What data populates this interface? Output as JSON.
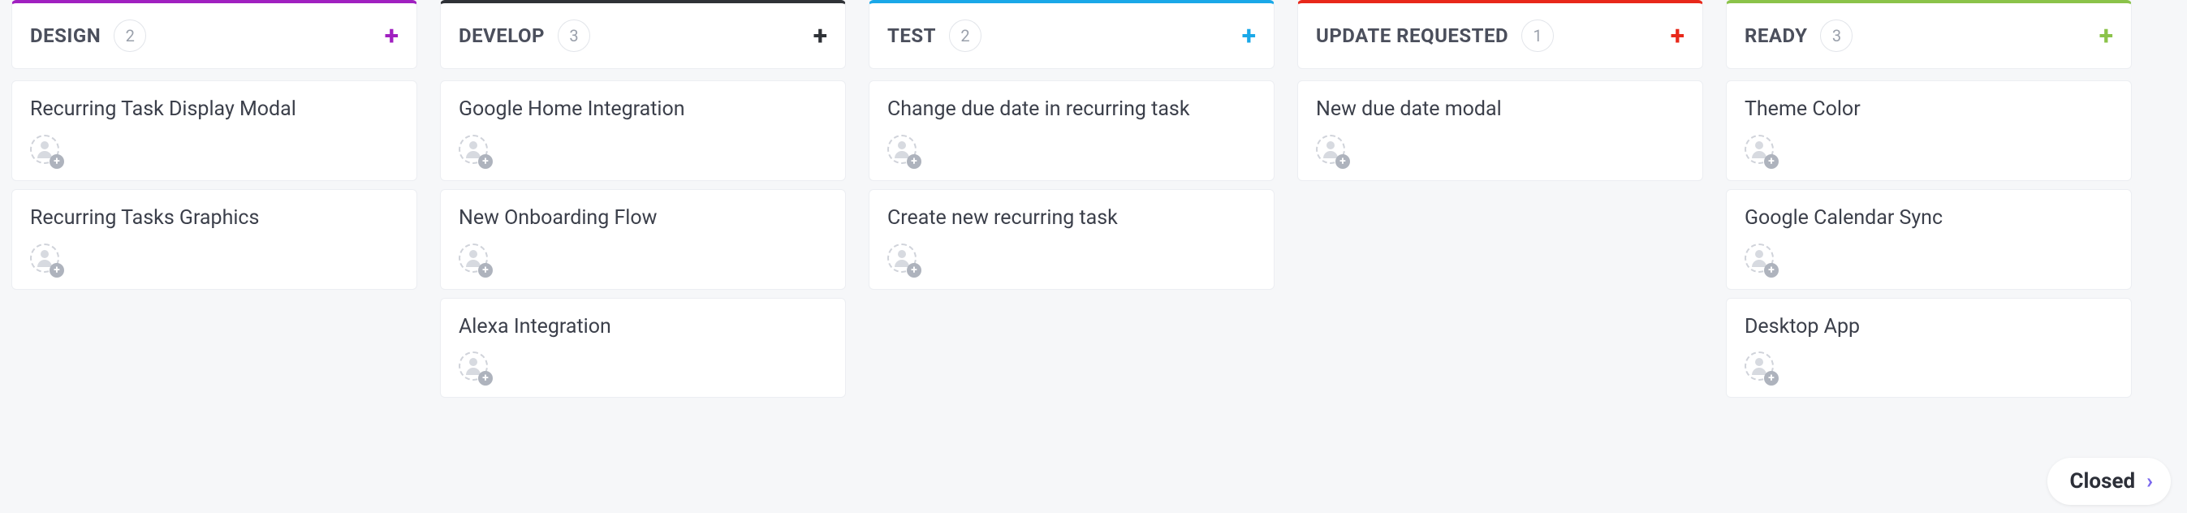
{
  "closed_label": "Closed",
  "columns": [
    {
      "id": "design",
      "title": "DESIGN",
      "count": 2,
      "accent": "#a020c0",
      "add_color": "#a020c0",
      "cards": [
        {
          "title": "Recurring Task Display Modal"
        },
        {
          "title": "Recurring Tasks Graphics"
        }
      ]
    },
    {
      "id": "develop",
      "title": "DEVELOP",
      "count": 3,
      "accent": "#2f3237",
      "add_color": "#2f3237",
      "cards": [
        {
          "title": "Google Home Integration"
        },
        {
          "title": "New Onboarding Flow"
        },
        {
          "title": "Alexa Integration"
        }
      ]
    },
    {
      "id": "test",
      "title": "TEST",
      "count": 2,
      "accent": "#1aa8e8",
      "add_color": "#1aa8e8",
      "cards": [
        {
          "title": "Change due date in recurring task"
        },
        {
          "title": "Create new recurring task"
        }
      ]
    },
    {
      "id": "update-requested",
      "title": "UPDATE REQUESTED",
      "count": 1,
      "accent": "#e8281a",
      "add_color": "#e8281a",
      "cards": [
        {
          "title": "New due date modal"
        }
      ]
    },
    {
      "id": "ready",
      "title": "READY",
      "count": 3,
      "accent": "#8bc34a",
      "add_color": "#8bc34a",
      "cards": [
        {
          "title": "Theme Color"
        },
        {
          "title": "Google Calendar Sync"
        },
        {
          "title": "Desktop App"
        }
      ]
    }
  ]
}
